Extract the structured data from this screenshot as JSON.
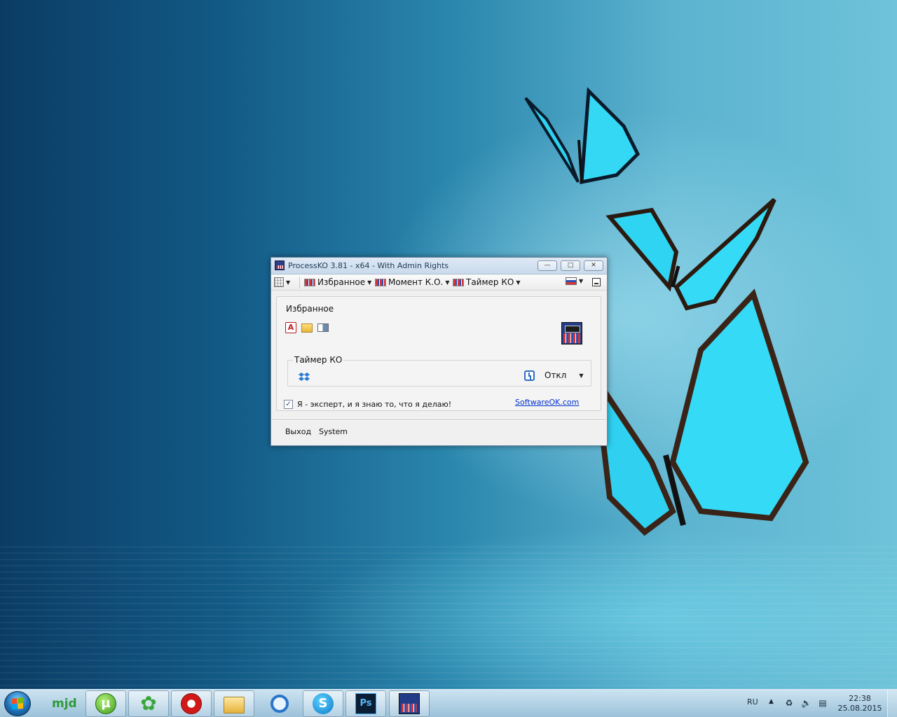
{
  "window": {
    "title": "ProcessKO 3.81 - x64 - With Admin Rights",
    "controls": {
      "minimize": "—",
      "maximize": "□",
      "close": "✕"
    }
  },
  "menubar": {
    "favorites": "Избранное",
    "moment": "Момент К.О.",
    "timer": "Таймер КО"
  },
  "favorites_group": {
    "label": "Избранное",
    "icons": [
      "acrobat-icon",
      "folder-icon",
      "window-icon"
    ]
  },
  "timer_group": {
    "label": "Таймер КО",
    "status": "Откл"
  },
  "expert_checkbox": {
    "checked": true,
    "check_glyph": "✓",
    "label": "Я - эксперт, и я знаю то, что я делаю!"
  },
  "link": "SoftwareOK.com",
  "bottom": {
    "exit": "Выход",
    "system": "System"
  },
  "taskbar": {
    "apps": [
      "mjd",
      "utorrent",
      "icq",
      "opera",
      "explorer",
      "qip",
      "skype",
      "photoshop",
      "processko"
    ],
    "mjd_label": "mjd",
    "utorrent_label": "µ",
    "icq_glyph": "✿",
    "skype_label": "S",
    "ps_label": "Ps",
    "language": "RU",
    "time": "22:38",
    "date": "25.08.2015"
  }
}
